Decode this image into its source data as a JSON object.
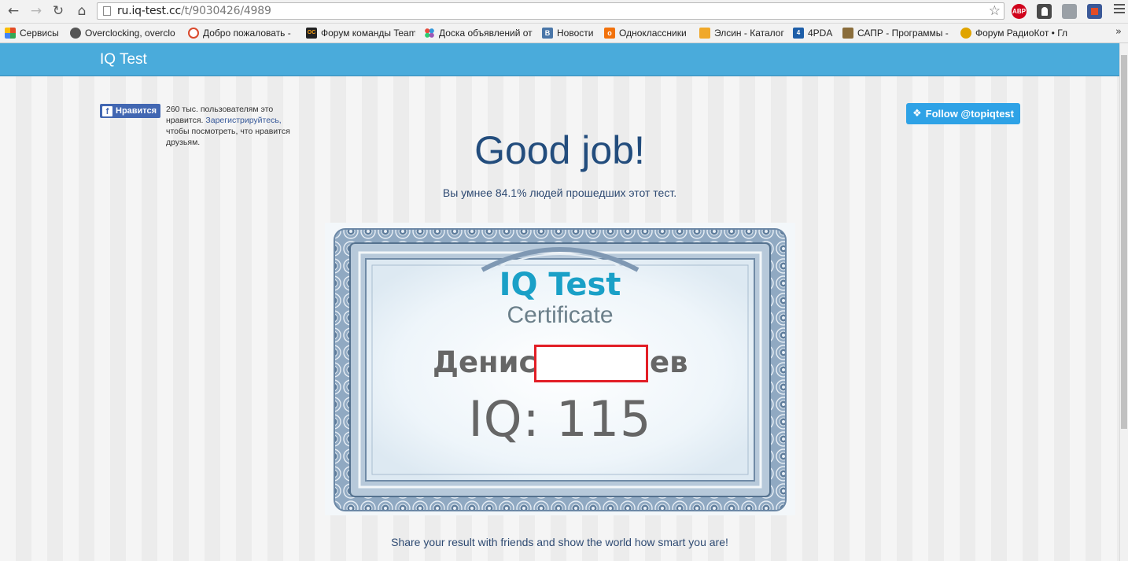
{
  "browser": {
    "url_host": "ru.iq-test.cc",
    "url_path": "/t/9030426/4989",
    "extensions": [
      "adblock-plus-icon",
      "ghost-icon",
      "puzzle-icon",
      "photo-icon"
    ],
    "ext_adblock_label": "ABP"
  },
  "bookmarks": [
    {
      "label": "Сервисы",
      "icon": "apps-grid-icon",
      "color": "#e34c26"
    },
    {
      "label": "Overclocking, overclo",
      "icon": "overclocking-icon",
      "color": "#555555"
    },
    {
      "label": "Добро пожаловать -",
      "icon": "alarm-clock-icon",
      "color": "#d9482b"
    },
    {
      "label": "Форум команды Team",
      "icon": "team-icon",
      "color": "#222222"
    },
    {
      "label": "Доска объявлений от",
      "icon": "dots-icon",
      "color": "#7c57c9"
    },
    {
      "label": "Новости",
      "icon": "vk-icon",
      "color": "#4a76a8"
    },
    {
      "label": "Одноклассники",
      "icon": "ok-icon",
      "color": "#f2720c"
    },
    {
      "label": "Элсин - Каталог",
      "icon": "elsin-icon",
      "color": "#f0a82a"
    },
    {
      "label": "4PDA",
      "icon": "4pda-icon",
      "color": "#1e5ea8"
    },
    {
      "label": "САПР - Программы -",
      "icon": "books-icon",
      "color": "#8a6d3b"
    },
    {
      "label": "Форум РадиоКот • Гл",
      "icon": "cat-icon",
      "color": "#e0a400"
    }
  ],
  "site": {
    "brand": "IQ Test",
    "fb_like_label": "Нравится",
    "fb_text_a": "260 тыс. пользователям это нравится. ",
    "fb_text_link": "Зарегистрируйтесь,",
    "fb_text_b": " чтобы посмотреть, что нравится друзьям.",
    "twitter_label": "Follow @topiqtest",
    "headline": "Good job!",
    "subline": "Вы умнее 84.1% людей прошедших этот тест.",
    "share": "Share your result with friends and show the world how smart you are!"
  },
  "certificate": {
    "title": "IQ Test",
    "subtitle": "Certificate",
    "name_start": "Денис",
    "name_end": "ев",
    "iq_text": "IQ: 115"
  },
  "colors": {
    "header": "#4aabdb",
    "headline": "#234d7d",
    "certificate_border": "#7f98b3",
    "redaction": "#e21e26"
  }
}
